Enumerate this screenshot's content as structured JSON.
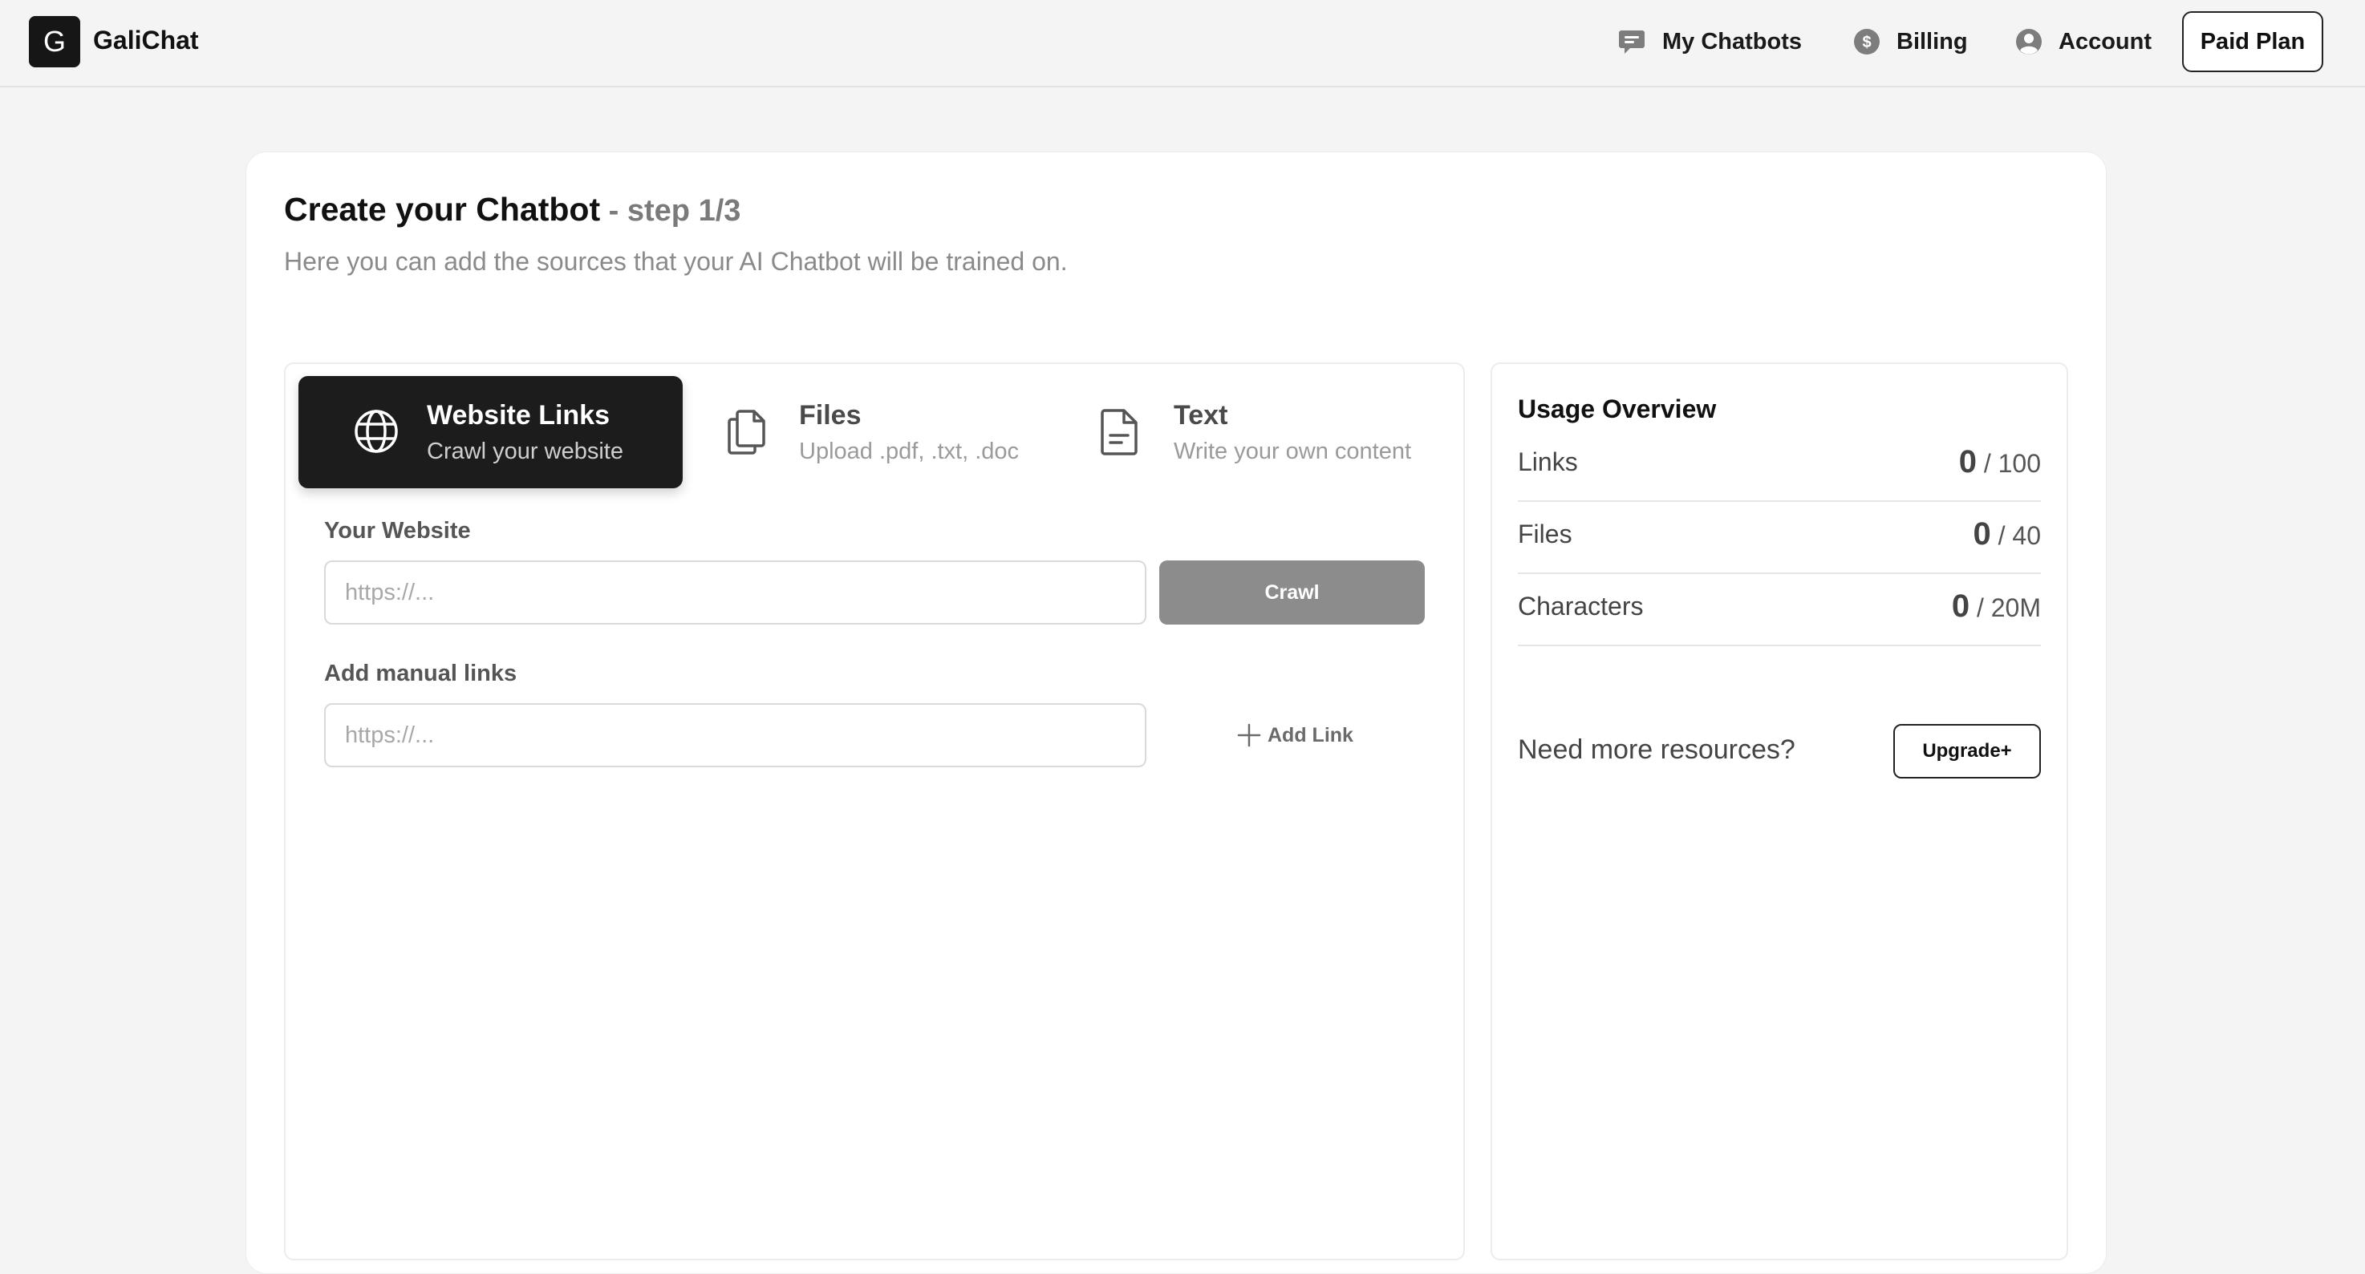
{
  "app": {
    "logo_letter": "G",
    "brand": "GaliChat"
  },
  "nav": {
    "my_chatbots": "My Chatbots",
    "billing": "Billing",
    "account": "Account",
    "paid_plan": "Paid Plan"
  },
  "page": {
    "title": "Create your Chatbot",
    "step": " - step 1/3",
    "subtitle": "Here you can add the sources that your AI Chatbot will be trained on."
  },
  "source_tabs": [
    {
      "title": "Website Links",
      "desc": "Crawl your website",
      "icon": "globe-icon",
      "active": true
    },
    {
      "title": "Files",
      "desc": "Upload .pdf, .txt, .doc",
      "icon": "files-icon",
      "active": false
    },
    {
      "title": "Text",
      "desc": "Write your own content",
      "icon": "document-icon",
      "active": false
    }
  ],
  "website_form": {
    "website_label": "Your Website",
    "website_placeholder": "https://...",
    "website_value": "",
    "crawl_label": "Crawl",
    "manual_label": "Add manual links",
    "manual_placeholder": "https://...",
    "manual_value": "",
    "add_link_label": "Add Link"
  },
  "usage": {
    "title": "Usage Overview",
    "rows": [
      {
        "label": "Links",
        "used": "0",
        "limit": " / 100"
      },
      {
        "label": "Files",
        "used": "0",
        "limit": " / 40"
      },
      {
        "label": "Characters",
        "used": "0",
        "limit": " / 20M"
      }
    ],
    "need_more": "Need more resources?",
    "upgrade_label": "Upgrade+"
  },
  "colors": {
    "background": "#f4f4f4",
    "active_tab": "#1c1c1c",
    "crawl_button": "#8c8c8c"
  }
}
